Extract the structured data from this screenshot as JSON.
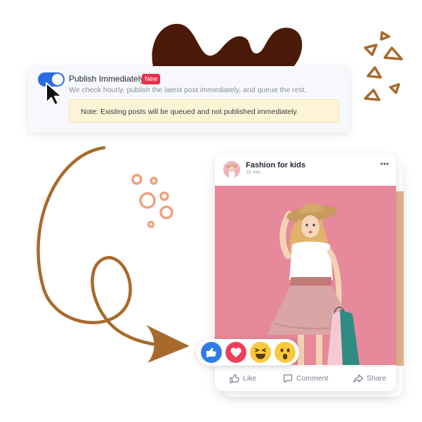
{
  "settings": {
    "toggle_label": "Publish Immediately",
    "badge": "New",
    "description": "We check hourly, publish the latest post immediately, and queue the rest.",
    "note": "Note: Existing posts will be queued and not published immediately.",
    "toggle_on": true
  },
  "post": {
    "page_name": "Fashion for kids",
    "time": "15 min",
    "actions": [
      {
        "label": "Like",
        "icon": "thumbs-up-outline-icon"
      },
      {
        "label": "Comment",
        "icon": "comment-icon"
      },
      {
        "label": "Share",
        "icon": "share-icon"
      }
    ]
  },
  "reactions": [
    "like-reaction-icon",
    "love-reaction-icon",
    "haha-reaction-icon",
    "wow-reaction-icon"
  ],
  "colors": {
    "toggle": "#2d6cdf",
    "badge": "#e8304a",
    "note_bg": "#fdf4d8",
    "photo_bg": "#e6899a",
    "brown_accent": "#a86a2c",
    "dark_blob": "#4a1a08",
    "peach_circles": "#f0a27c"
  }
}
